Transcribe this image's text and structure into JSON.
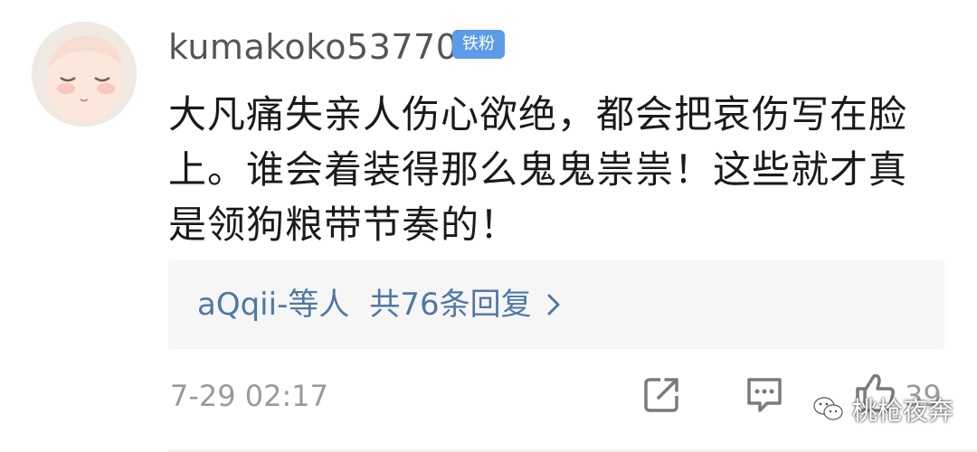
{
  "comment": {
    "username": "kumakoko53770",
    "badge": "铁粉",
    "text_lines": [
      "大凡痛失亲人伤心欲绝，都会把哀伤写在脸",
      "上。谁会着装得那么鬼鬼祟祟！这些就才真",
      "是领狗粮带节奏的！"
    ],
    "replies": {
      "users": "aQqii-等人",
      "count_text": "共76条回复"
    },
    "timestamp": "7-29 02:17",
    "like_count": "39"
  },
  "watermark": {
    "text": "桃枪夜奔"
  },
  "colors": {
    "badge": "#5b9be8",
    "link": "#4f78a6",
    "muted": "#9a9a9a",
    "reply_bg": "#f6f6f6"
  },
  "icons": [
    "share-icon",
    "comment-icon",
    "like-icon",
    "chevron-right-icon",
    "wechat-icon"
  ]
}
